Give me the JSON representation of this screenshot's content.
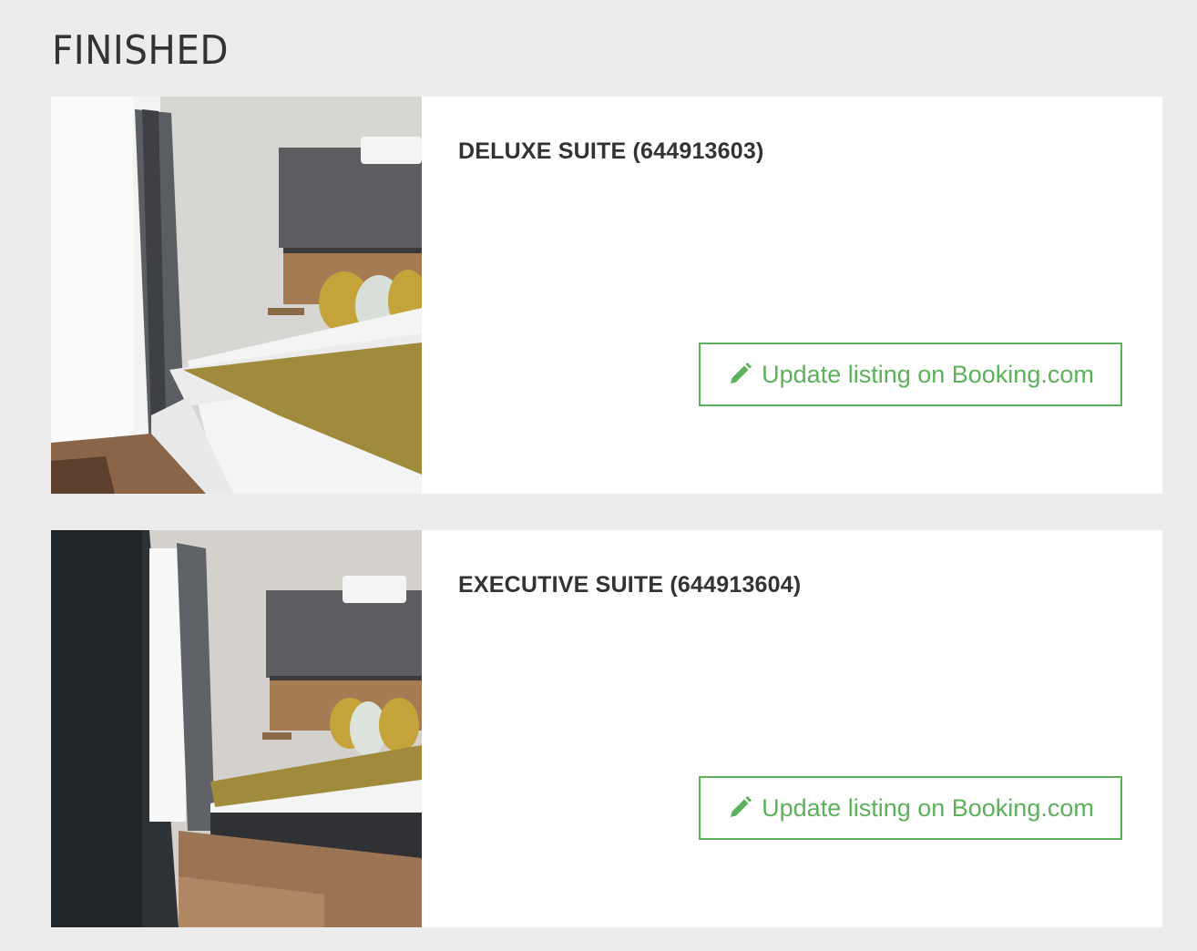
{
  "section": {
    "title": "FINISHED"
  },
  "rooms": [
    {
      "title": "DELUXE SUITE (644913603)",
      "button_label": "Update listing on Booking.com",
      "has_arrow": true
    },
    {
      "title": "EXECUTIVE SUITE (644913604)",
      "button_label": "Update listing on Booking.com",
      "has_arrow": false
    }
  ],
  "colors": {
    "accent": "#5cb15a",
    "arrow": "#e8321f",
    "background": "#ececec"
  },
  "icons": {
    "edit": "pencil-icon"
  }
}
